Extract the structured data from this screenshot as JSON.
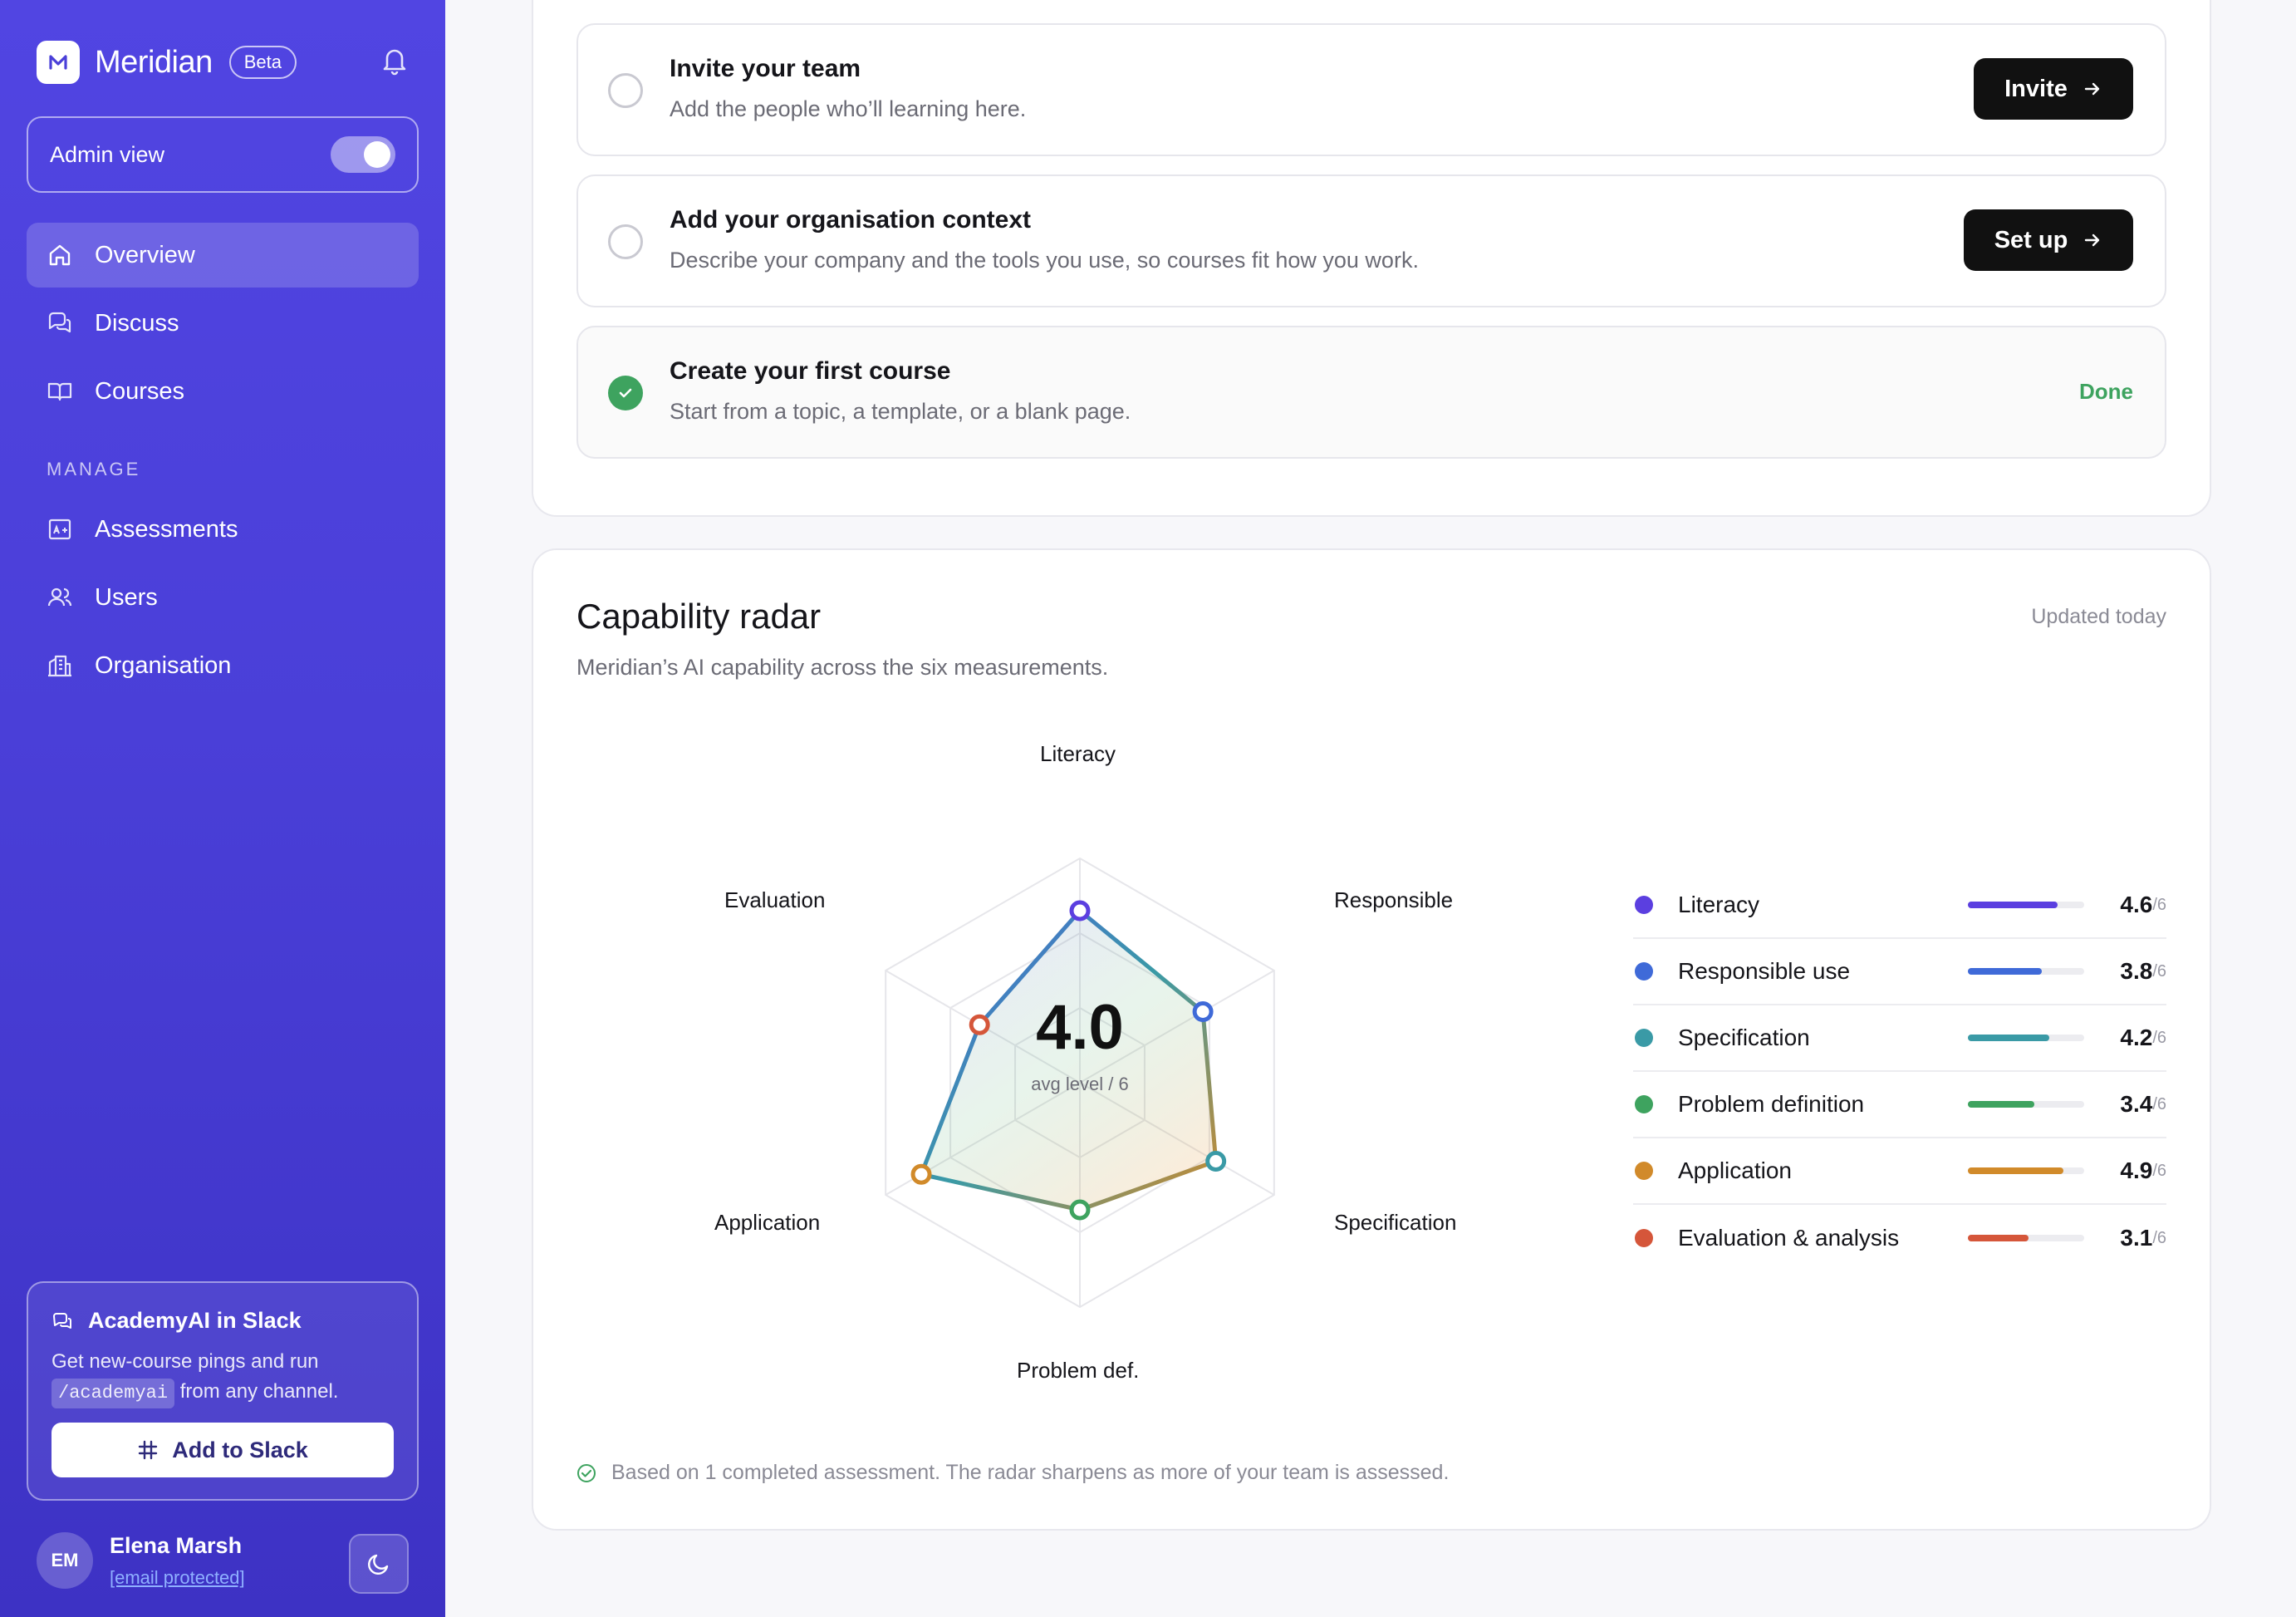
{
  "app": {
    "name": "Meridian",
    "badge": "Beta"
  },
  "admin": {
    "label": "Admin view",
    "enabled": true
  },
  "nav": {
    "items": [
      {
        "label": "Overview",
        "icon": "home-icon",
        "active": true
      },
      {
        "label": "Discuss",
        "icon": "chat-icon"
      },
      {
        "label": "Courses",
        "icon": "book-icon"
      }
    ],
    "section_label": "MANAGE",
    "manage_items": [
      {
        "label": "Assessments",
        "icon": "assessment-icon"
      },
      {
        "label": "Users",
        "icon": "users-icon"
      },
      {
        "label": "Organisation",
        "icon": "building-icon"
      }
    ]
  },
  "slack": {
    "title": "AcademyAI in Slack",
    "desc_before": "Get new-course pings and run",
    "command": "/academyai",
    "desc_after": "from any channel.",
    "button": "Add to Slack"
  },
  "user": {
    "initials": "EM",
    "name": "Elena Marsh",
    "email": "[email protected]"
  },
  "steps": [
    {
      "title": "Invite your team",
      "desc": "Add the people who’ll learning here.",
      "action": "Invite",
      "done": false
    },
    {
      "title": "Add your organisation context",
      "desc": "Describe your company and the tools you use, so courses fit how you work.",
      "action": "Set up",
      "done": false
    },
    {
      "title": "Create your first course",
      "desc": "Start from a topic, a template, or a blank page.",
      "action": "Done",
      "done": true
    }
  ],
  "radar": {
    "title": "Capability radar",
    "subtitle": "Meridian’s AI capability across the six measurements.",
    "updated": "Updated today",
    "avg_value": "4.0",
    "avg_label": "avg level / 6",
    "axis_labels": [
      "Literacy",
      "Responsible",
      "Specification",
      "Problem def.",
      "Application",
      "Evaluation"
    ],
    "footnote": "Based on 1 completed assessment. The radar sharpens as more of your team is assessed."
  },
  "chart_data": {
    "type": "radar",
    "max": 6,
    "axes": [
      "Literacy",
      "Responsible",
      "Specification",
      "Problem def.",
      "Application",
      "Evaluation"
    ],
    "values": [
      4.6,
      3.8,
      4.2,
      3.4,
      4.9,
      3.1
    ],
    "colors": [
      "#5b3fe0",
      "#3f6ad8",
      "#3a9aa6",
      "#3ea35f",
      "#d18a2a",
      "#d5563a"
    ],
    "legend": [
      {
        "name": "Literacy",
        "value": "4.6",
        "max": "/6"
      },
      {
        "name": "Responsible use",
        "value": "3.8",
        "max": "/6"
      },
      {
        "name": "Specification",
        "value": "4.2",
        "max": "/6"
      },
      {
        "name": "Problem definition",
        "value": "3.4",
        "max": "/6"
      },
      {
        "name": "Application",
        "value": "4.9",
        "max": "/6"
      },
      {
        "name": "Evaluation & analysis",
        "value": "3.1",
        "max": "/6"
      }
    ]
  }
}
